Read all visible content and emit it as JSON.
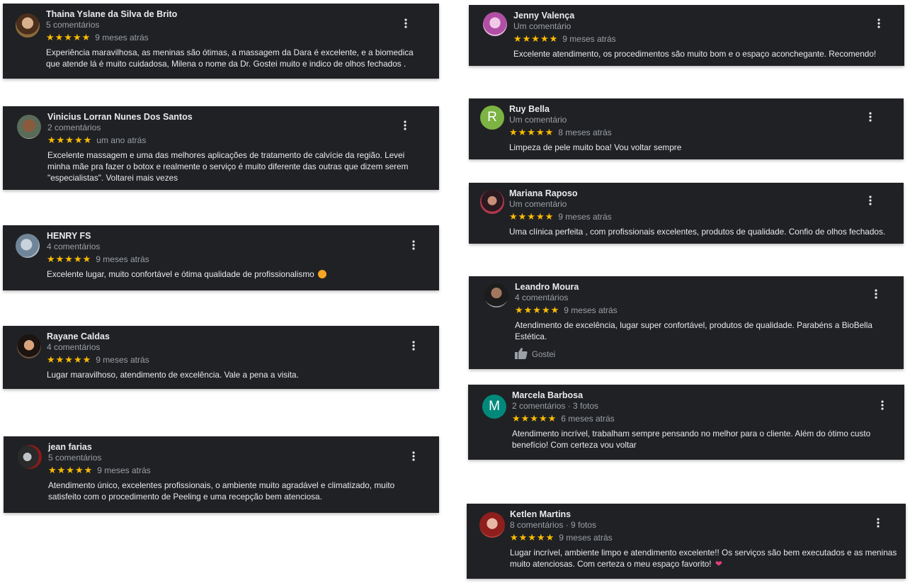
{
  "colors": {
    "card_bg": "#202124",
    "star": "#fbbc04",
    "meta": "#9aa0a6",
    "text": "#e8eaed"
  },
  "reviews": [
    {
      "author": "Thaina Yslane da Silva de Brito",
      "meta": "5 comentários",
      "stars": "★★★★★",
      "time": "9 meses atrás",
      "text": "Experiência maravilhosa, as meninas são ótimas, a massagem da Dara é excelente, e a biomedica que atende lá é muito cuidadosa, Milena o nome da Dr. Gostei muito e indico de olhos fechados ."
    },
    {
      "author": "Vinicius Lorran Nunes Dos Santos",
      "meta": "2 comentários",
      "stars": "★★★★★",
      "time": "um ano atrás",
      "text": "Excelente massagem e uma das melhores aplicações de tratamento de calvície da região. Levei minha mãe pra fazer o botox e realmente o serviço é muito diferente das outras que dizem serem \"especialistas\". Voltarei mais vezes"
    },
    {
      "author": "HENRY FS",
      "meta": "4 comentários",
      "stars": "★★★★★",
      "time": "9 meses atrás",
      "text": "Excelente lugar, muito confortável e ótima qualidade de profissionalismo"
    },
    {
      "author": "Rayane Caldas",
      "meta": "4 comentários",
      "stars": "★★★★★",
      "time": "9 meses atrás",
      "text": "Lugar maravilhoso, atendimento de excelência. Vale a pena a visita."
    },
    {
      "author": "jean farias",
      "meta": "5 comentários",
      "stars": "★★★★★",
      "time": "9 meses atrás",
      "text": "Atendimento único, excelentes profissionais, o ambiente muito agradável e climatizado, muito satisfeito com o procedimento de Peeling e uma recepção bem atenciosa."
    },
    {
      "author": "Jenny Valença",
      "meta": "Um comentário",
      "stars": "★★★★★",
      "time": "9 meses atrás",
      "text": "Excelente atendimento, os procedimentos são muito bom e o espaço aconchegante. Recomendo!"
    },
    {
      "author": "Ruy Bella",
      "meta": "Um comentário",
      "stars": "★★★★★",
      "time": "8 meses atrás",
      "initial": "R",
      "avatar_color": "#7cb342",
      "text": "Limpeza de pele muito boa! Vou voltar sempre"
    },
    {
      "author": "Mariana Raposo",
      "meta": "Um comentário",
      "stars": "★★★★★",
      "time": "9 meses atrás",
      "text": "Uma clínica perfeita , com profissionais excelentes, produtos de qualidade. Confio de olhos fechados."
    },
    {
      "author": "Leandro Moura",
      "meta": "4 comentários",
      "stars": "★★★★★",
      "time": "9 meses atrás",
      "text": "Atendimento de excelência, lugar super confortável, produtos de qualidade. Parabéns a BioBella Estética.",
      "like_label": "Gostei"
    },
    {
      "author": "Marcela Barbosa",
      "meta": "2 comentários · 3 fotos",
      "stars": "★★★★★",
      "time": "6 meses atrás",
      "initial": "M",
      "avatar_color": "#00897b",
      "text": "Atendimento incrível, trabalham sempre pensando no melhor para o cliente. Além do ótimo custo benefício! Com certeza vou voltar"
    },
    {
      "author": "Ketlen Martins",
      "meta": "8 comentários · 9 fotos",
      "stars": "★★★★★",
      "time": "9 meses atrás",
      "text": "Lugar incrível, ambiente limpo e atendimento excelente!! Os serviços são bem executados e as meninas muito atenciosas. Com certeza o meu espaço favorito!"
    }
  ]
}
